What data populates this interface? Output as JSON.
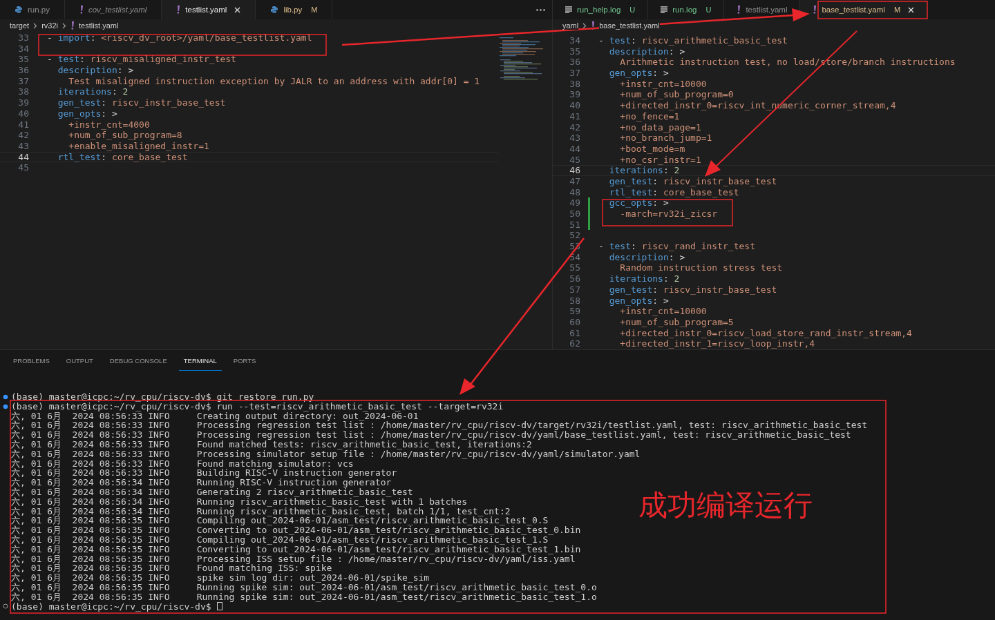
{
  "left_editor": {
    "tabs": [
      {
        "label": "run.py",
        "kind": "python",
        "selected": false,
        "preview": false
      },
      {
        "label": "cov_testlist.yaml",
        "kind": "yaml",
        "selected": false,
        "preview": true
      },
      {
        "label": "testlist.yaml",
        "kind": "yaml",
        "selected": true,
        "preview": false
      },
      {
        "label": "lib.py",
        "kind": "python",
        "selected": false,
        "preview": false,
        "color": "#e2c08d",
        "badge": "M"
      }
    ],
    "breadcrumb": [
      "target",
      "rv32i",
      "testlist.yaml"
    ],
    "lines": [
      {
        "num": "33",
        "code": [
          {
            "kind": "punct",
            "text": "- "
          },
          {
            "kind": "key",
            "text": "import"
          },
          {
            "kind": "punct",
            "text": ": "
          },
          {
            "kind": "str",
            "text": "<riscv_dv_root>/yaml/base_testlist.yaml"
          }
        ]
      },
      {
        "num": "34"
      },
      {
        "num": "35",
        "code": [
          {
            "kind": "punct",
            "text": "- "
          },
          {
            "kind": "key",
            "text": "test"
          },
          {
            "kind": "punct",
            "text": ": "
          },
          {
            "kind": "str",
            "text": "riscv_misaligned_instr_test"
          }
        ]
      },
      {
        "num": "36",
        "code": [
          {
            "kind": "key",
            "text": "  description"
          },
          {
            "kind": "punct",
            "text": ": >"
          }
        ]
      },
      {
        "num": "37",
        "code": [
          {
            "kind": "str",
            "text": "    Test misaligned instruction exception by JALR to an address with addr[0] = 1"
          }
        ]
      },
      {
        "num": "38",
        "code": [
          {
            "kind": "key",
            "text": "  iterations"
          },
          {
            "kind": "punct",
            "text": ": "
          },
          {
            "kind": "num",
            "text": "2"
          }
        ]
      },
      {
        "num": "39",
        "code": [
          {
            "kind": "key",
            "text": "  gen_test"
          },
          {
            "kind": "punct",
            "text": ": "
          },
          {
            "kind": "str",
            "text": "riscv_instr_base_test"
          }
        ]
      },
      {
        "num": "40",
        "code": [
          {
            "kind": "key",
            "text": "  gen_opts"
          },
          {
            "kind": "punct",
            "text": ": >"
          }
        ]
      },
      {
        "num": "41",
        "code": [
          {
            "kind": "str",
            "text": "    +instr_cnt=4000"
          }
        ]
      },
      {
        "num": "42",
        "code": [
          {
            "kind": "str",
            "text": "    +num_of_sub_program=8"
          }
        ]
      },
      {
        "num": "43",
        "code": [
          {
            "kind": "str",
            "text": "    +enable_misaligned_instr=1"
          }
        ]
      },
      {
        "num": "44",
        "current": true,
        "code": [
          {
            "kind": "key",
            "text": "  rtl_test"
          },
          {
            "kind": "punct",
            "text": ": "
          },
          {
            "kind": "str",
            "text": "core_base_test"
          }
        ]
      },
      {
        "num": "45"
      }
    ]
  },
  "right_editor": {
    "tabs": [
      {
        "label": "run_help.log",
        "kind": "log",
        "selected": false,
        "preview": false,
        "color": "#73c991",
        "badge": "U"
      },
      {
        "label": "run.log",
        "kind": "log",
        "selected": false,
        "preview": false,
        "color": "#73c991",
        "badge": "U"
      },
      {
        "label": "testlist.yaml",
        "kind": "yaml",
        "selected": false,
        "preview": false
      },
      {
        "label": "base_testlist.yaml",
        "kind": "yaml",
        "selected": true,
        "preview": false,
        "color": "#e2c08d",
        "badge": "M"
      }
    ],
    "breadcrumb": [
      "yaml",
      "base_testlist.yaml"
    ],
    "lines": [
      {
        "num": "34",
        "code": [
          {
            "kind": "punct",
            "text": "- "
          },
          {
            "kind": "key",
            "text": "test"
          },
          {
            "kind": "punct",
            "text": ": "
          },
          {
            "kind": "str",
            "text": "riscv_arithmetic_basic_test"
          }
        ]
      },
      {
        "num": "35",
        "code": [
          {
            "kind": "key",
            "text": "  description"
          },
          {
            "kind": "punct",
            "text": ": >"
          }
        ]
      },
      {
        "num": "36",
        "code": [
          {
            "kind": "str",
            "text": "    Arithmetic instruction test, no load/store/branch instructions"
          }
        ]
      },
      {
        "num": "37",
        "code": [
          {
            "kind": "key",
            "text": "  gen_opts"
          },
          {
            "kind": "punct",
            "text": ": >"
          }
        ]
      },
      {
        "num": "38",
        "code": [
          {
            "kind": "str",
            "text": "    +instr_cnt=10000"
          }
        ]
      },
      {
        "num": "39",
        "code": [
          {
            "kind": "str",
            "text": "    +num_of_sub_program=0"
          }
        ]
      },
      {
        "num": "40",
        "code": [
          {
            "kind": "str",
            "text": "    +directed_instr_0=riscv_int_numeric_corner_stream,4"
          }
        ]
      },
      {
        "num": "41",
        "code": [
          {
            "kind": "str",
            "text": "    +no_fence=1"
          }
        ]
      },
      {
        "num": "42",
        "code": [
          {
            "kind": "str",
            "text": "    +no_data_page=1"
          }
        ]
      },
      {
        "num": "43",
        "code": [
          {
            "kind": "str",
            "text": "    +no_branch_jump=1"
          }
        ]
      },
      {
        "num": "44",
        "code": [
          {
            "kind": "str",
            "text": "    +boot_mode=m"
          }
        ]
      },
      {
        "num": "45",
        "code": [
          {
            "kind": "str",
            "text": "    +no_csr_instr=1"
          }
        ]
      },
      {
        "num": "46",
        "current": true,
        "code": [
          {
            "kind": "key",
            "text": "  iterations"
          },
          {
            "kind": "punct",
            "text": ": "
          },
          {
            "kind": "num",
            "text": "2"
          }
        ]
      },
      {
        "num": "47",
        "code": [
          {
            "kind": "key",
            "text": "  gen_test"
          },
          {
            "kind": "punct",
            "text": ": "
          },
          {
            "kind": "str",
            "text": "riscv_instr_base_test"
          }
        ]
      },
      {
        "num": "48",
        "code": [
          {
            "kind": "key",
            "text": "  rtl_test"
          },
          {
            "kind": "punct",
            "text": ": "
          },
          {
            "kind": "str",
            "text": "core_base_test"
          }
        ]
      },
      {
        "num": "49",
        "changed": true,
        "code": [
          {
            "kind": "key",
            "text": "  gcc_opts"
          },
          {
            "kind": "punct",
            "text": ": >"
          }
        ]
      },
      {
        "num": "50",
        "changed": true,
        "code": [
          {
            "kind": "str",
            "text": "    -march=rv32i_zicsr"
          }
        ]
      },
      {
        "num": "51",
        "changed": true
      },
      {
        "num": "52"
      },
      {
        "num": "53",
        "code": [
          {
            "kind": "punct",
            "text": "- "
          },
          {
            "kind": "key",
            "text": "test"
          },
          {
            "kind": "punct",
            "text": ": "
          },
          {
            "kind": "str",
            "text": "riscv_rand_instr_test"
          }
        ]
      },
      {
        "num": "54",
        "code": [
          {
            "kind": "key",
            "text": "  description"
          },
          {
            "kind": "punct",
            "text": ": >"
          }
        ]
      },
      {
        "num": "55",
        "code": [
          {
            "kind": "str",
            "text": "    Random instruction stress test"
          }
        ]
      },
      {
        "num": "56",
        "code": [
          {
            "kind": "key",
            "text": "  iterations"
          },
          {
            "kind": "punct",
            "text": ": "
          },
          {
            "kind": "num",
            "text": "2"
          }
        ]
      },
      {
        "num": "57",
        "code": [
          {
            "kind": "key",
            "text": "  gen_test"
          },
          {
            "kind": "punct",
            "text": ": "
          },
          {
            "kind": "str",
            "text": "riscv_instr_base_test"
          }
        ]
      },
      {
        "num": "58",
        "code": [
          {
            "kind": "key",
            "text": "  gen_opts"
          },
          {
            "kind": "punct",
            "text": ": >"
          }
        ]
      },
      {
        "num": "59",
        "code": [
          {
            "kind": "str",
            "text": "    +instr_cnt=10000"
          }
        ]
      },
      {
        "num": "60",
        "code": [
          {
            "kind": "str",
            "text": "    +num_of_sub_program=5"
          }
        ]
      },
      {
        "num": "61",
        "code": [
          {
            "kind": "str",
            "text": "    +directed_instr_0=riscv_load_store_rand_instr_stream,4"
          }
        ]
      },
      {
        "num": "62",
        "code": [
          {
            "kind": "str",
            "text": "    +directed_instr_1=riscv_loop_instr,4"
          }
        ]
      }
    ]
  },
  "panel": {
    "tabs": [
      {
        "label": "PROBLEMS",
        "selected": false
      },
      {
        "label": "OUTPUT",
        "selected": false
      },
      {
        "label": "DEBUG CONSOLE",
        "selected": false
      },
      {
        "label": "TERMINAL",
        "selected": true
      },
      {
        "label": "PORTS",
        "selected": false
      }
    ],
    "terminal": [
      {
        "kind": "prompt",
        "finished": true,
        "text": "(base) master@icpc:~/rv_cpu/riscv-dv$ git restore run.py"
      },
      {
        "kind": "prompt",
        "finished": true,
        "text": "(base) master@icpc:~/rv_cpu/riscv-dv$ run --test=riscv_arithmetic_basic_test --target=rv32i"
      },
      {
        "kind": "log",
        "text": "六, 01 6月  2024 08:56:33 INFO     Creating output directory: out_2024-06-01"
      },
      {
        "kind": "log",
        "text": "六, 01 6月  2024 08:56:33 INFO     Processing regression test list : /home/master/rv_cpu/riscv-dv/target/rv32i/testlist.yaml, test: riscv_arithmetic_basic_test"
      },
      {
        "kind": "log",
        "text": "六, 01 6月  2024 08:56:33 INFO     Processing regression test list : /home/master/rv_cpu/riscv-dv/yaml/base_testlist.yaml, test: riscv_arithmetic_basic_test"
      },
      {
        "kind": "log",
        "text": "六, 01 6月  2024 08:56:33 INFO     Found matched tests: riscv_arithmetic_basic_test, iterations:2"
      },
      {
        "kind": "log",
        "text": "六, 01 6月  2024 08:56:33 INFO     Processing simulator setup file : /home/master/rv_cpu/riscv-dv/yaml/simulator.yaml"
      },
      {
        "kind": "log",
        "text": "六, 01 6月  2024 08:56:33 INFO     Found matching simulator: vcs"
      },
      {
        "kind": "log",
        "text": "六, 01 6月  2024 08:56:33 INFO     Building RISC-V instruction generator"
      },
      {
        "kind": "log",
        "text": "六, 01 6月  2024 08:56:34 INFO     Running RISC-V instruction generator"
      },
      {
        "kind": "log",
        "text": "六, 01 6月  2024 08:56:34 INFO     Generating 2 riscv_arithmetic_basic_test"
      },
      {
        "kind": "log",
        "text": "六, 01 6月  2024 08:56:34 INFO     Running riscv_arithmetic_basic_test with 1 batches"
      },
      {
        "kind": "log",
        "text": "六, 01 6月  2024 08:56:34 INFO     Running riscv_arithmetic_basic_test, batch 1/1, test_cnt:2"
      },
      {
        "kind": "log",
        "text": "六, 01 6月  2024 08:56:35 INFO     Compiling out_2024-06-01/asm_test/riscv_arithmetic_basic_test_0.S"
      },
      {
        "kind": "log",
        "text": "六, 01 6月  2024 08:56:35 INFO     Converting to out_2024-06-01/asm_test/riscv_arithmetic_basic_test_0.bin"
      },
      {
        "kind": "log",
        "text": "六, 01 6月  2024 08:56:35 INFO     Compiling out_2024-06-01/asm_test/riscv_arithmetic_basic_test_1.S"
      },
      {
        "kind": "log",
        "text": "六, 01 6月  2024 08:56:35 INFO     Converting to out_2024-06-01/asm_test/riscv_arithmetic_basic_test_1.bin"
      },
      {
        "kind": "log",
        "text": "六, 01 6月  2024 08:56:35 INFO     Processing ISS setup file : /home/master/rv_cpu/riscv-dv/yaml/iss.yaml"
      },
      {
        "kind": "log",
        "text": "六, 01 6月  2024 08:56:35 INFO     Found matching ISS: spike"
      },
      {
        "kind": "log",
        "text": "六, 01 6月  2024 08:56:35 INFO     spike sim log dir: out_2024-06-01/spike_sim"
      },
      {
        "kind": "log",
        "text": "六, 01 6月  2024 08:56:35 INFO     Running spike sim: out_2024-06-01/asm_test/riscv_arithmetic_basic_test_0.o"
      },
      {
        "kind": "log",
        "text": "六, 01 6月  2024 08:56:35 INFO     Running spike sim: out_2024-06-01/asm_test/riscv_arithmetic_basic_test_1.o"
      },
      {
        "kind": "prompt",
        "finished": false,
        "cursor": true,
        "text": "(base) master@icpc:~/rv_cpu/riscv-dv$"
      }
    ]
  },
  "annotation": {
    "note": "成功编译运行"
  }
}
